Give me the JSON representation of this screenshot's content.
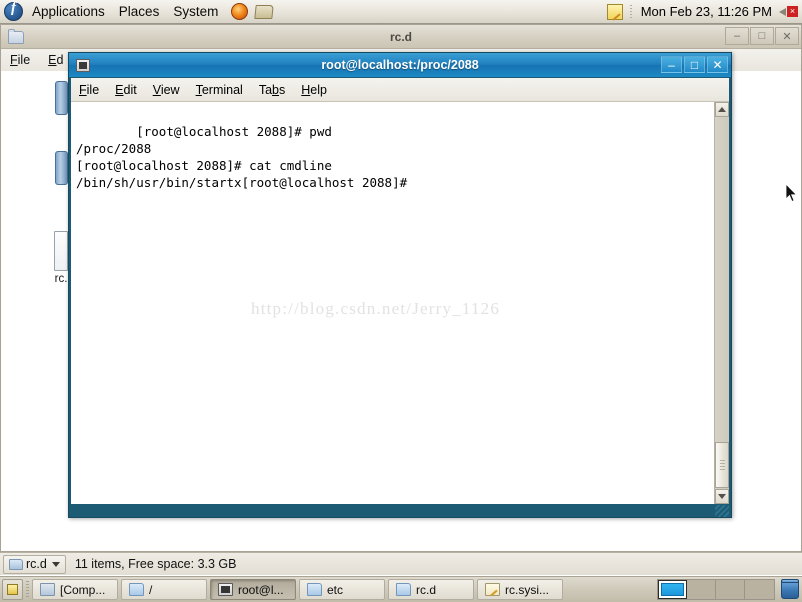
{
  "top_panel": {
    "logo": "fedora-logo",
    "menus": [
      {
        "label": "Applications",
        "name": "applications-menu"
      },
      {
        "label": "Places",
        "name": "places-menu"
      },
      {
        "label": "System",
        "name": "system-menu"
      }
    ],
    "launchers": [
      {
        "name": "firefox-launcher-icon"
      },
      {
        "name": "file-manager-launcher-icon"
      }
    ],
    "tray": {
      "note_icon": "note-icon",
      "clock": "Mon Feb 23, 11:26 PM",
      "volume_icon": "speaker-muted-icon",
      "volume_mute_mark": "×"
    }
  },
  "file_manager_window": {
    "title": "rc.d",
    "folder_icon": "folder-icon",
    "menus": [
      {
        "label": "File",
        "mnemonic": "F"
      },
      {
        "label": "Ed",
        "mnemonic": "E"
      }
    ],
    "window_buttons": {
      "minimize": "–",
      "maximize": "□",
      "close": "✕"
    },
    "files": [
      {
        "label": "",
        "name": "file-item-1",
        "type": "file"
      },
      {
        "label": "",
        "name": "file-item-2",
        "type": "file"
      },
      {
        "label": "rc.",
        "name": "file-item-3",
        "type": "document"
      }
    ]
  },
  "file_manager_statusbar": {
    "location_label": "rc.d",
    "location_icon": "folder-icon",
    "dropdown_icon": "chevron-down-icon",
    "status_text": "11 items, Free space: 3.3 GB"
  },
  "terminal_window": {
    "title": "root@localhost:/proc/2088",
    "app_icon": "terminal-icon",
    "menus": [
      {
        "label": "File",
        "mnemonic": "F"
      },
      {
        "label": "Edit",
        "mnemonic": "E"
      },
      {
        "label": "View",
        "mnemonic": "V"
      },
      {
        "label": "Terminal",
        "mnemonic": "T"
      },
      {
        "label": "Tabs",
        "mnemonic": "b"
      },
      {
        "label": "Help",
        "mnemonic": "H"
      }
    ],
    "window_buttons": {
      "minimize": "–",
      "maximize": "□",
      "close": "✕"
    },
    "content": "[root@localhost 2088]# pwd\n/proc/2088\n[root@localhost 2088]# cat cmdline\n/bin/sh/usr/bin/startx[root@localhost 2088]#",
    "watermark": "http://blog.csdn.net/Jerry_1126",
    "scrollbar": {
      "up_arrow": "scroll-up-icon",
      "down_arrow": "scroll-down-icon"
    }
  },
  "taskbar": {
    "show_desktop_icon": "show-desktop-icon",
    "tasks": [
      {
        "label": "[Comp...",
        "icon": "computer-icon",
        "active": false,
        "name": "taskbar-item-computer"
      },
      {
        "label": "/",
        "icon": "folder-icon",
        "active": false,
        "name": "taskbar-item-root"
      },
      {
        "label": "root@l...",
        "icon": "terminal-icon",
        "active": true,
        "name": "taskbar-item-terminal"
      },
      {
        "label": "etc",
        "icon": "folder-icon",
        "active": false,
        "name": "taskbar-item-etc"
      },
      {
        "label": "rc.d",
        "icon": "folder-icon",
        "active": false,
        "name": "taskbar-item-rcd"
      },
      {
        "label": "rc.sysi...",
        "icon": "notepad-icon",
        "active": false,
        "name": "taskbar-item-rcsysinit"
      }
    ],
    "workspaces": [
      {
        "active": true
      },
      {
        "active": false
      },
      {
        "active": false
      },
      {
        "active": false
      }
    ],
    "trash_icon": "trash-icon"
  },
  "colors": {
    "terminal_title_blue": "#1f7fbe",
    "terminal_border": "#1d5a73",
    "panel_bg": "#d8d3c6",
    "taskbar_bg": "#cdc8b8"
  }
}
